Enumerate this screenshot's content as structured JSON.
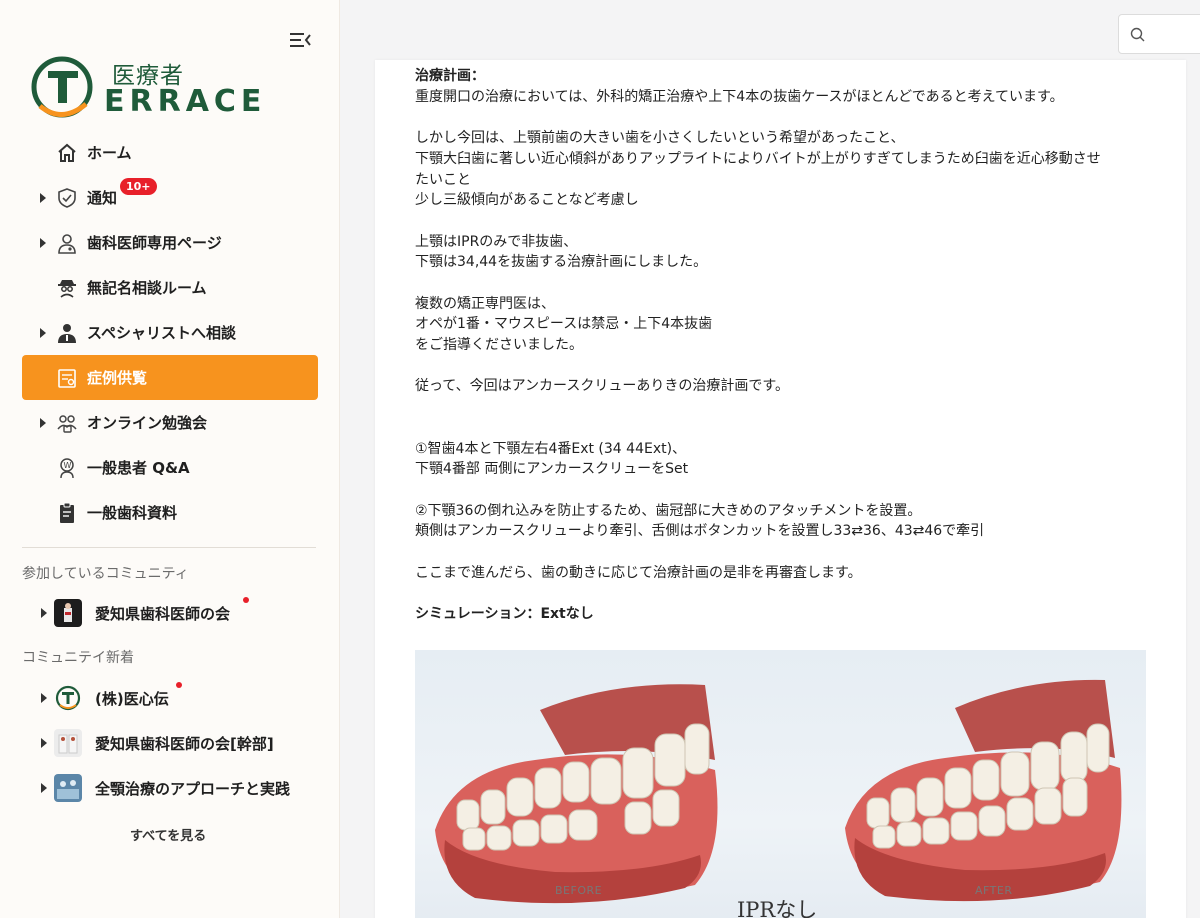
{
  "sidebar": {
    "logo": {
      "kanji": "医療者",
      "word": "ERRACE"
    },
    "nav": [
      {
        "label": "ホーム",
        "icon": "home-icon",
        "caret": false
      },
      {
        "label": "通知",
        "icon": "shield-check-icon",
        "caret": true,
        "badge": "10+"
      },
      {
        "label": "歯科医師専用ページ",
        "icon": "dentist-icon",
        "caret": true
      },
      {
        "label": "無記名相談ルーム",
        "icon": "anonymous-icon",
        "caret": false
      },
      {
        "label": "スペシャリストへ相談",
        "icon": "specialist-icon",
        "caret": true
      },
      {
        "label": "症例供覧",
        "icon": "case-report-icon",
        "caret": false,
        "active": true
      },
      {
        "label": "オンライン勉強会",
        "icon": "online-study-icon",
        "caret": true
      },
      {
        "label": "一般患者 Q&A",
        "icon": "patient-qa-icon",
        "caret": false
      },
      {
        "label": "一般歯科資料",
        "icon": "clipboard-icon",
        "caret": false
      }
    ],
    "joined_label": "参加しているコミュニティ",
    "joined": [
      {
        "label": "愛知県歯科医師の会",
        "unread": true
      }
    ],
    "new_label": "コミュニテイ新着",
    "new": [
      {
        "label": "(株)医心伝",
        "unread": true
      },
      {
        "label": "愛知県歯科医師の会[幹部]",
        "unread": false
      },
      {
        "label": "全顎治療のアプローチと実践",
        "unread": false
      }
    ],
    "see_all": "すべてを見る"
  },
  "search": {
    "placeholder": ""
  },
  "post": {
    "lines": [
      {
        "text": "治療計画：",
        "bold": true
      },
      {
        "text": "重度開口の治療においては、外科的矯正治療や上下4本の抜歯ケースがほとんどであると考えています。"
      },
      {
        "text": ""
      },
      {
        "text": "しかし今回は、上顎前歯の大きい歯を小さくしたいという希望があったこと、"
      },
      {
        "text": "下顎大臼歯に著しい近心傾斜がありアップライトによりバイトが上がりすぎてしまうため臼歯を近心移動させ"
      },
      {
        "text": "たいこと"
      },
      {
        "text": "少し三級傾向があることなど考慮し"
      },
      {
        "text": ""
      },
      {
        "text": "上顎はIPRのみで非抜歯、"
      },
      {
        "text": "下顎は34,44を抜歯する治療計画にしました。"
      },
      {
        "text": ""
      },
      {
        "text": "複数の矯正専門医は、"
      },
      {
        "text": "オペが1番・マウスピースは禁忌・上下4本抜歯"
      },
      {
        "text": "をご指導くださいました。"
      },
      {
        "text": ""
      },
      {
        "text": "従って、今回はアンカースクリューありきの治療計画です。"
      },
      {
        "text": ""
      },
      {
        "text": ""
      },
      {
        "text": "①智歯4本と下顎左右4番Ext (34 44Ext)、"
      },
      {
        "text": "下顎4番部 両側にアンカースクリューをSet"
      },
      {
        "text": ""
      },
      {
        "text": "②下顎36の倒れ込みを防止するため、歯冠部に大きめのアタッチメントを設置。"
      },
      {
        "text": "頬側はアンカースクリューより牽引、舌側はボタンカットを設置し33⇄36、43⇄46で牽引"
      },
      {
        "text": ""
      },
      {
        "text": "ここまで進んだら、歯の動きに応じて治療計画の是非を再審査します。"
      },
      {
        "text": ""
      },
      {
        "text": "シミュレーション：Extなし",
        "bold": true
      }
    ],
    "figure": {
      "before_label": "BEFORE",
      "after_label": "AFTER",
      "caption": "IPRなし"
    }
  },
  "colors": {
    "accent": "#f7931e",
    "brand_green": "#1f5b3a",
    "badge_red": "#e8202a"
  }
}
